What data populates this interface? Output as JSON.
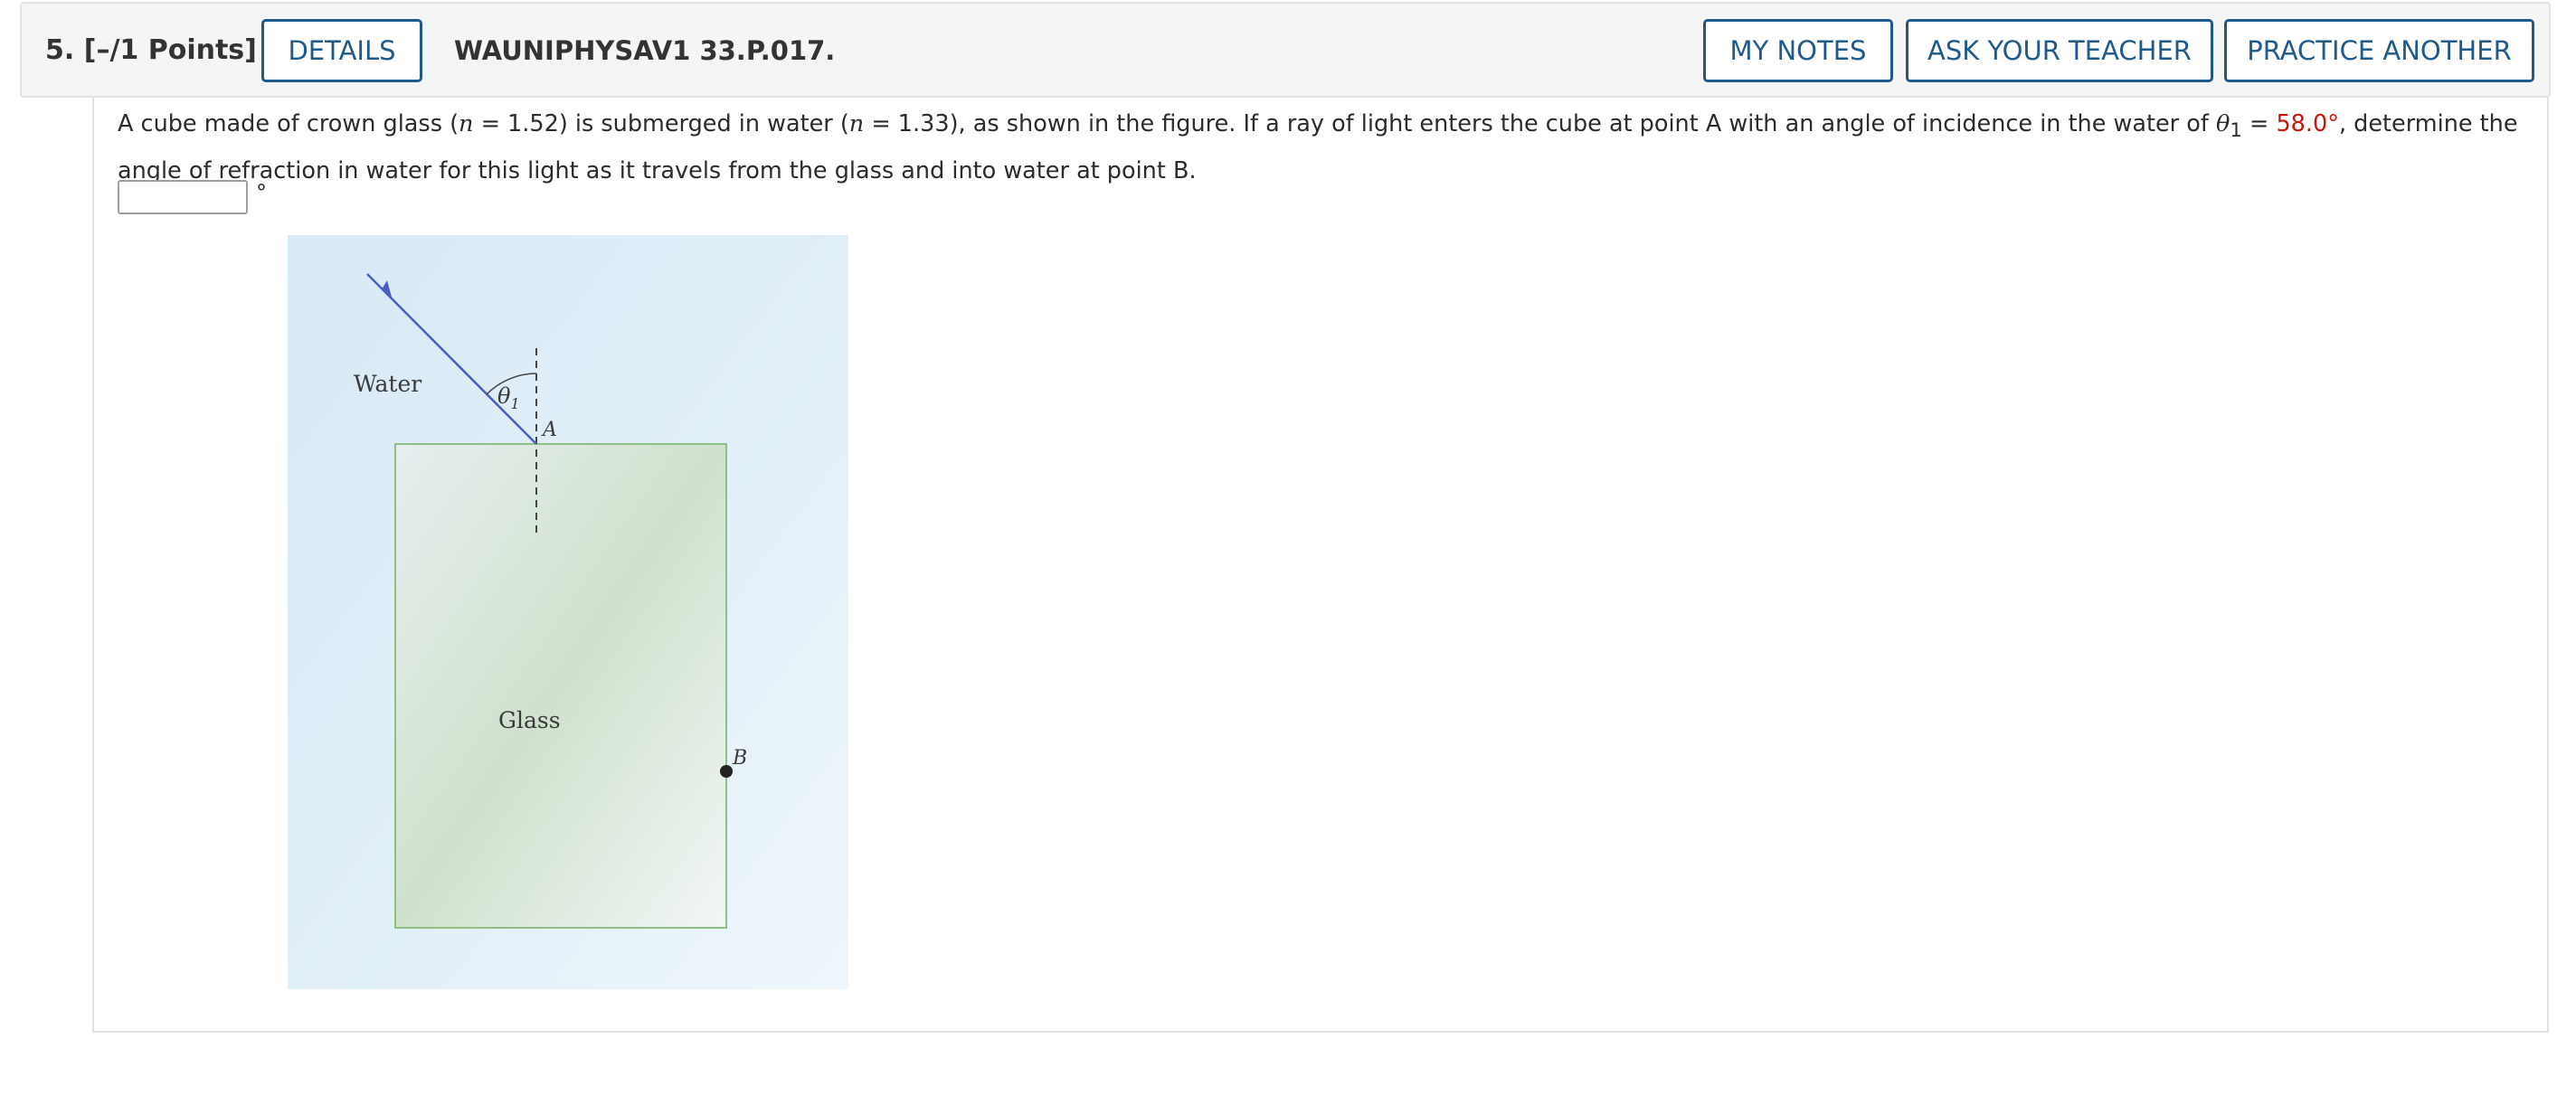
{
  "header": {
    "question_number": "5.",
    "points": "[–/1 Points]",
    "details_button": "DETAILS",
    "assignment_id": "WAUNIPHYSAV1 33.P.017.",
    "my_notes_button": "MY NOTES",
    "ask_teacher_button": "ASK YOUR TEACHER",
    "practice_another_button": "PRACTICE ANOTHER"
  },
  "question": {
    "text_1": "A cube made of crown glass (",
    "n_symbol_1": "n",
    "text_2": " = 1.52) is submerged in water (",
    "n_symbol_2": "n",
    "text_3": " = 1.33), as shown in the figure. If a ray of light enters the cube at point A with an angle of incidence in the water of ",
    "theta_symbol": "θ",
    "theta_subscript": "1",
    "text_4": " = ",
    "angle_value": "58.0°",
    "text_5": ", determine the angle of refraction in water for this light as it travels from the glass and into water at point B."
  },
  "answer": {
    "value": "",
    "unit": "°"
  },
  "figure": {
    "water_label": "Water",
    "glass_label": "Glass",
    "theta_label": "θ",
    "theta_sub": "1",
    "point_a_label": "A",
    "point_b_label": "B"
  },
  "colors": {
    "accent": "#1f5a8c",
    "value_highlight": "#c4170c",
    "ray": "#4a5fbf",
    "glass_border": "#8fbf86"
  }
}
